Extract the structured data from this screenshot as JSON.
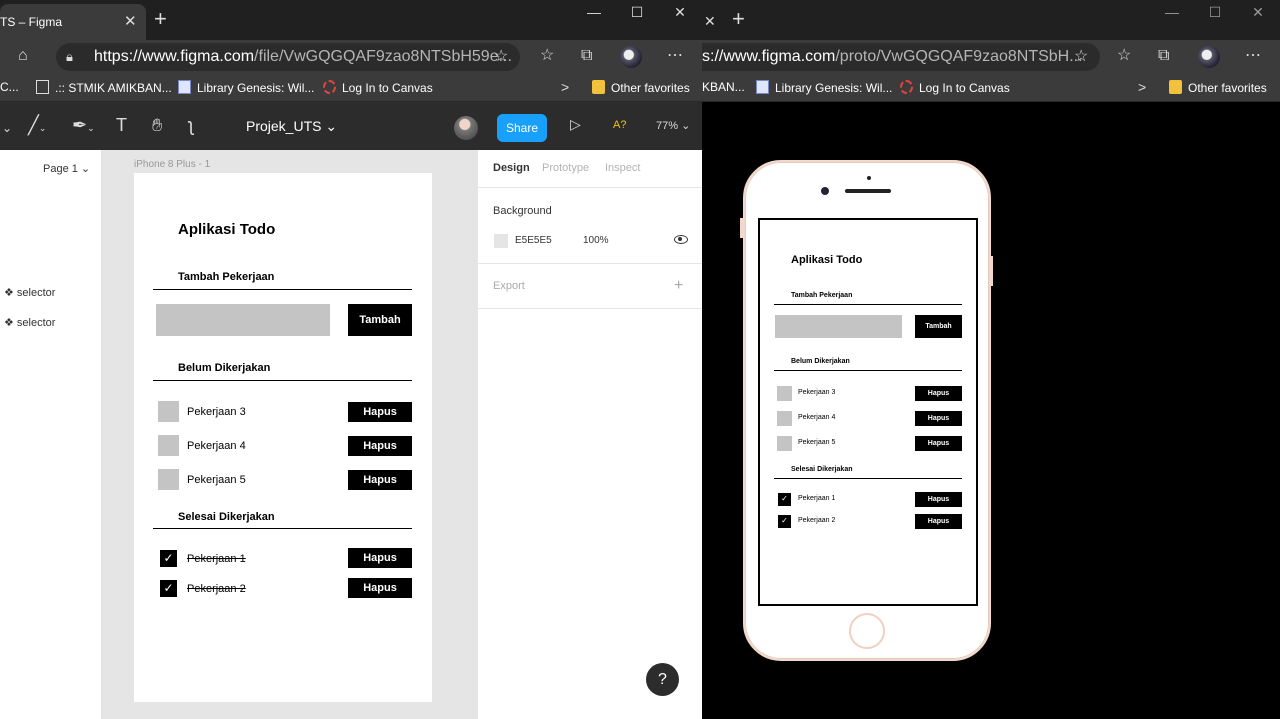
{
  "left_window": {
    "tab_title": "TS – Figma",
    "tab_close": "✕",
    "new_tab": "+",
    "window_controls": {
      "minimize": "—",
      "maximize": "☐",
      "close": "✕"
    },
    "url_host": "https://www.figma.com",
    "url_path": "/file/VwGQGQAF9zao8NTSbH59e...",
    "favorites": [
      {
        "label": "C..."
      },
      {
        "label": ".:: STMIK AMIKBAN..."
      },
      {
        "label": "Library Genesis: Wil..."
      },
      {
        "label": "Log In to Canvas"
      },
      {
        "label": "Other favorites"
      }
    ],
    "more_chevron": ">",
    "figma": {
      "file_title": "Projek_UTS",
      "share_label": "Share",
      "a_label": "A?",
      "zoom": "77%",
      "page_label": "Page 1",
      "layers": [
        "❖ selector",
        "❖ selector"
      ],
      "frame_label": "iPhone 8 Plus - 1",
      "tabs": [
        "Design",
        "Prototype",
        "Inspect"
      ],
      "background_label": "Background",
      "bg_hex": "E5E5E5",
      "bg_opacity": "100%",
      "export_label": "Export",
      "help": "?"
    }
  },
  "right_window": {
    "tab_close": "✕",
    "new_tab": "+",
    "window_controls": {
      "minimize": "—",
      "maximize": "☐",
      "close": "✕"
    },
    "url_host": "s://www.figma.com",
    "url_path": "/proto/VwGQGQAF9zao8NTSbH...",
    "favorites": [
      {
        "label": "KBAN..."
      },
      {
        "label": "Library Genesis: Wil..."
      },
      {
        "label": "Log In to Canvas"
      },
      {
        "label": "Other favorites"
      }
    ],
    "more_chevron": ">"
  },
  "todo_app": {
    "title": "Aplikasi Todo",
    "add_section": "Tambah Pekerjaan",
    "add_button": "Tambah",
    "pending_section": "Belum Dikerjakan",
    "pending_items": [
      "Pekerjaan 3",
      "Pekerjaan 4",
      "Pekerjaan 5"
    ],
    "done_section": "Selesai Dikerjakan",
    "done_items": [
      "Pekerjaan 1",
      "Pekerjaan 2"
    ],
    "delete_button": "Hapus",
    "check": "✓"
  },
  "colors": {
    "figma_share": "#18a0fb",
    "figma_toolbar": "#2c2c2c",
    "canvas_bg": "#e5e5e5"
  }
}
